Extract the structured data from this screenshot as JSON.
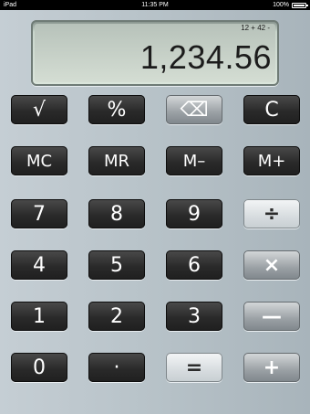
{
  "status": {
    "device": "iPad",
    "time": "11:35 PM",
    "battery_text": "100%"
  },
  "display": {
    "tape": "12 + 42 -",
    "value": "1,234.56"
  },
  "keys": {
    "sqrt": "√",
    "percent": "%",
    "backspace": "⌫",
    "clear": "C",
    "mc": "MC",
    "mr": "MR",
    "m_minus": "M–",
    "m_plus": "M+",
    "seven": "7",
    "eight": "8",
    "nine": "9",
    "divide": "÷",
    "four": "4",
    "five": "5",
    "six": "6",
    "multiply": "×",
    "one": "1",
    "two": "2",
    "three": "3",
    "minus": "—",
    "zero": "0",
    "decimal": "·",
    "equals": "=",
    "plus": "+"
  },
  "colors": {
    "key_dark": "#2a2a2a",
    "key_light": "#e8ecee",
    "key_gray": "#9aa0a4",
    "display_bg": "#d4ddd3"
  }
}
